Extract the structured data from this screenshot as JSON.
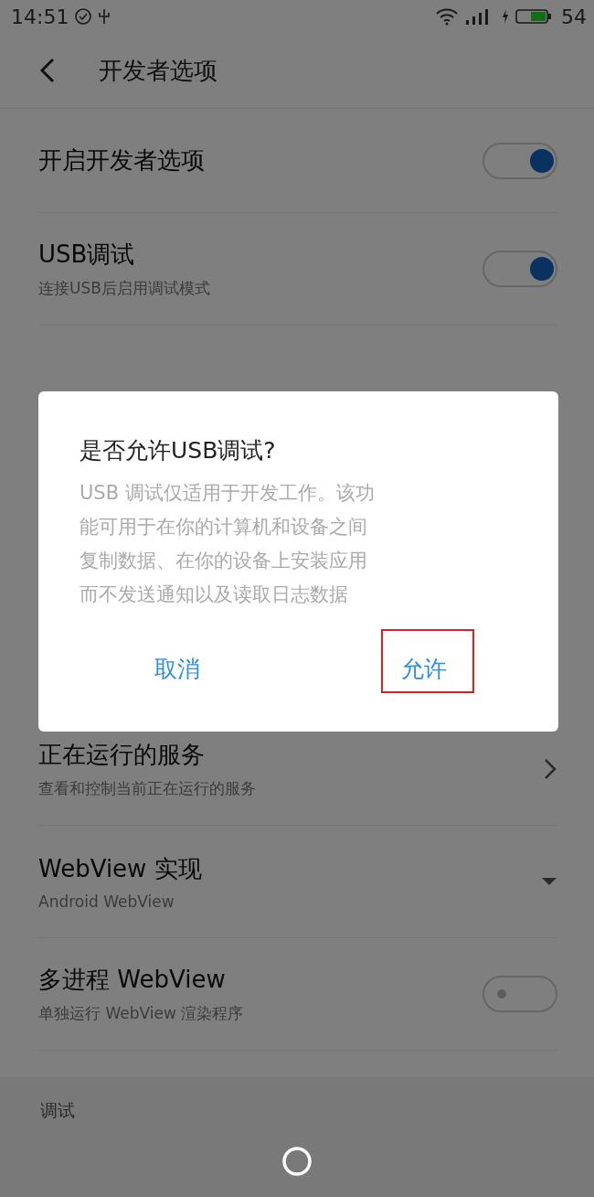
{
  "status_bar": {
    "time": "14:51",
    "battery": "54"
  },
  "header": {
    "title": "开发者选项"
  },
  "rows_top": [
    {
      "kind": "toggle",
      "title": "开启开发者选项",
      "on": true
    },
    {
      "kind": "toggle",
      "title": "USB调试",
      "subtitle": "连接USB后启用调试模式",
      "on": true
    }
  ],
  "rows_bottom": [
    {
      "kind": "chevron",
      "title": "正在运行的服务",
      "subtitle": "查看和控制当前正在运行的服务"
    },
    {
      "kind": "dropdown",
      "title": "WebView 实现",
      "subtitle": "Android WebView"
    },
    {
      "kind": "toggle",
      "title": "多进程 WebView",
      "subtitle": "单独运行 WebView 渲染程序",
      "on": false
    }
  ],
  "section_header": "调试",
  "dialog": {
    "title": "是否允许USB调试?",
    "message": "USB 调试仅适用于开发工作。该功能可用于在你的计算机和设备之间复制数据、在你的设备上安装应用而不发送通知以及读取日志数据",
    "buttons": [
      {
        "label": "取消",
        "highlighted": false
      },
      {
        "label": "允许",
        "highlighted": true
      }
    ]
  }
}
